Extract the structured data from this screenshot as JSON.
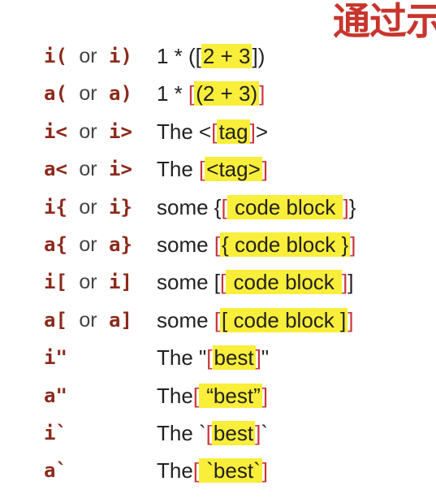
{
  "header": {
    "title": "通过示"
  },
  "rows": [
    {
      "k1": "i(",
      "k2": "i)",
      "pre": "1 * ([",
      "hl": "2 + 3",
      "post": "])",
      "b": "",
      "e": ""
    },
    {
      "k1": "a(",
      "k2": "a)",
      "pre": "1 * ",
      "b": "[",
      "hl": "(2 + 3)",
      "e": "]",
      "post": ""
    },
    {
      "k1": "i<",
      "k2": "i>",
      "pre": "The <",
      "b": "[",
      "hl": "tag",
      "e": "]",
      "post": ">"
    },
    {
      "k1": "a<",
      "k2": "i>",
      "pre": "The ",
      "b": "[",
      "hl": "<tag>",
      "e": "]",
      "post": ""
    },
    {
      "k1": "i{",
      "k2": "i}",
      "pre": "some {",
      "b": "[",
      "hl": " code block ",
      "e": "]",
      "post": "}"
    },
    {
      "k1": "a{",
      "k2": "a}",
      "pre": "some ",
      "b": "[",
      "hl": "{ code block }",
      "e": "]",
      "post": ""
    },
    {
      "k1": "i[",
      "k2": "i]",
      "pre": "some [",
      "b": "[",
      "hl": " code block ",
      "e": "]",
      "post": "]"
    },
    {
      "k1": "a[",
      "k2": "a]",
      "pre": "some ",
      "b": "[",
      "hl": "[ code block ]",
      "e": "]",
      "post": ""
    },
    {
      "k1": "i\"",
      "k2": "",
      "pre": "The \"",
      "b": "[",
      "hl": "best",
      "e": "]",
      "post": "\""
    },
    {
      "k1": "a\"",
      "k2": "",
      "pre": "The",
      "b": "[",
      "hl": " “best”",
      "e": "]",
      "post": ""
    },
    {
      "k1": "i`",
      "k2": "",
      "pre": "The `",
      "b": "[",
      "hl": "best",
      "e": "]",
      "post": "`"
    },
    {
      "k1": "a`",
      "k2": "",
      "pre": "The",
      "b": "[",
      "hl": " `best`",
      "e": "]",
      "post": ""
    }
  ],
  "or_word": "or"
}
